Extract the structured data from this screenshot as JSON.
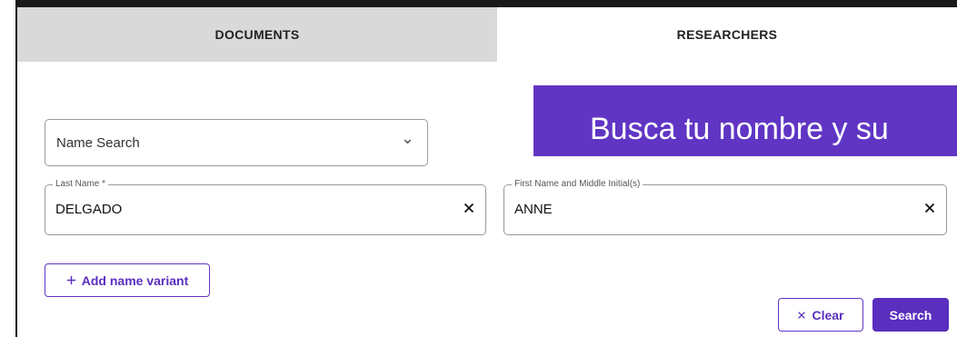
{
  "tabs": [
    {
      "label": "DOCUMENTS",
      "active": false
    },
    {
      "label": "RESEARCHERS",
      "active": true
    }
  ],
  "banner": {
    "text": "Busca tu nombre y su"
  },
  "name_search": {
    "label": "Name Search"
  },
  "last_name": {
    "label": "Last Name *",
    "value": "DELGADO"
  },
  "first_name": {
    "label": "First Name and Middle Initial(s)",
    "value": "ANNE"
  },
  "buttons": {
    "add_variant_label": "Add name variant",
    "clear_label": "Clear",
    "search_label": "Search"
  },
  "icons": {
    "chevron": "chevron-down-icon",
    "clear_field": "close-icon",
    "plus": "plus-icon"
  },
  "colors": {
    "accent": "#5a2fbf",
    "banner": "#6035c4",
    "inactive_tab": "#d9d9d9"
  }
}
